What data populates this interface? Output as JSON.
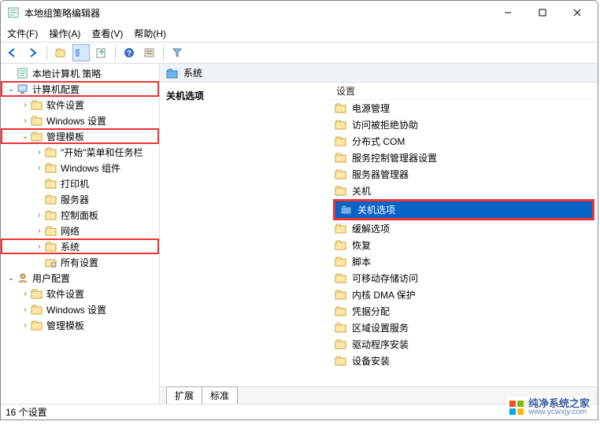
{
  "window": {
    "title": "本地组策略编辑器"
  },
  "menu": {
    "file": "文件(F)",
    "action": "操作(A)",
    "view": "查看(V)",
    "help": "帮助(H)"
  },
  "tree": {
    "root": "本地计算机 策略",
    "computer_config": "计算机配置",
    "cc_software": "软件设置",
    "cc_windows": "Windows 设置",
    "cc_admin_tpl": "管理模板",
    "at_start_taskbar": "\"开始\"菜单和任务栏",
    "at_windows_comp": "Windows 组件",
    "at_printer": "打印机",
    "at_server": "服务器",
    "at_control_panel": "控制面板",
    "at_network": "网络",
    "at_system": "系统",
    "at_all_settings": "所有设置",
    "user_config": "用户配置",
    "uc_software": "软件设置",
    "uc_windows": "Windows 设置",
    "uc_admin_tpl": "管理模板"
  },
  "content": {
    "header_title": "系统",
    "left_heading": "关机选项",
    "list_header": "设置",
    "items": [
      "电源管理",
      "访问被拒绝协助",
      "分布式 COM",
      "服务控制管理器设置",
      "服务器管理器",
      "关机",
      "关机选项",
      "缓解选项",
      "恢复",
      "脚本",
      "可移动存储访问",
      "内核 DMA 保护",
      "凭据分配",
      "区域设置服务",
      "驱动程序安装",
      "设备安装"
    ],
    "selected_index": 6
  },
  "tabs": {
    "extended": "扩展",
    "standard": "标准"
  },
  "status": {
    "text": "16 个设置"
  },
  "watermark": {
    "brand": "纯净系统之家",
    "url": "www.ycwxjy.com"
  }
}
